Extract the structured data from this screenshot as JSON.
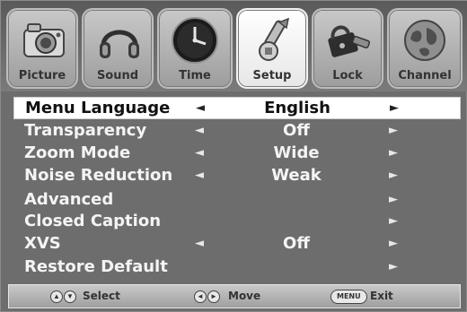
{
  "tabs": [
    {
      "label": "Picture",
      "icon": "camera-icon",
      "active": false
    },
    {
      "label": "Sound",
      "icon": "headphones-icon",
      "active": false
    },
    {
      "label": "Time",
      "icon": "clock-icon",
      "active": false
    },
    {
      "label": "Setup",
      "icon": "wrench-icon",
      "active": true
    },
    {
      "label": "Lock",
      "icon": "lock-icon",
      "active": false
    },
    {
      "label": "Channel",
      "icon": "globe-icon",
      "active": false
    }
  ],
  "menu": {
    "items": [
      {
        "label": "Menu Language",
        "value": "English",
        "left_arrow": "◄",
        "right_arrow": "►",
        "selected": true
      },
      {
        "label": "Transparency",
        "value": "Off",
        "left_arrow": "◄",
        "right_arrow": "►",
        "selected": false
      },
      {
        "label": "Zoom Mode",
        "value": "Wide",
        "left_arrow": "◄",
        "right_arrow": "►",
        "selected": false
      },
      {
        "label": "Noise Reduction",
        "value": "Weak",
        "left_arrow": "◄",
        "right_arrow": "►",
        "selected": false
      },
      {
        "label": "Advanced",
        "value": "",
        "left_arrow": "",
        "right_arrow": "►",
        "selected": false
      },
      {
        "label": "Closed Caption",
        "value": "",
        "left_arrow": "",
        "right_arrow": "►",
        "selected": false
      },
      {
        "label": "XVS",
        "value": "Off",
        "left_arrow": "◄",
        "right_arrow": "►",
        "selected": false
      },
      {
        "label": "Restore Default",
        "value": "",
        "left_arrow": "",
        "right_arrow": "►",
        "selected": false
      }
    ]
  },
  "hints": {
    "select_label": "Select",
    "move_label": "Move",
    "exit_label": "Exit",
    "menu_key": "MENU"
  },
  "colors": {
    "background": "#6d6d6d",
    "tab_active": "#ffffff",
    "tab_inactive": "#b5b5b5",
    "selected_row": "#ffffff",
    "text_light": "#f4f4f4",
    "text_dark": "#111111"
  }
}
